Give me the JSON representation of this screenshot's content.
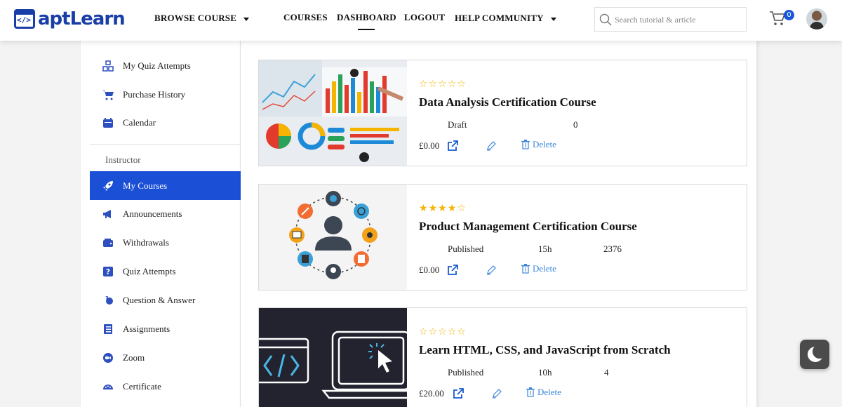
{
  "header": {
    "logo_text": "aptLearn",
    "logo_icon_text": "</>",
    "nav": {
      "browse_course": "BROWSE COURSE",
      "courses": "COURSES",
      "dashboard": "DASHBOARD",
      "logout": "LOGOUT",
      "help_community": "HELP COMMUNITY"
    },
    "search_placeholder": "Search tutorial & article",
    "cart_count": "0"
  },
  "sidebar": {
    "items_top": [
      {
        "label": "My Quiz Attempts",
        "icon": "quiz-attempts-icon"
      },
      {
        "label": "Purchase History",
        "icon": "cart-icon"
      },
      {
        "label": "Calendar",
        "icon": "calendar-icon"
      }
    ],
    "instructor_heading": "Instructor",
    "items_instructor": [
      {
        "label": "My Courses",
        "icon": "rocket-icon",
        "active": true
      },
      {
        "label": "Announcements",
        "icon": "megaphone-icon"
      },
      {
        "label": "Withdrawals",
        "icon": "wallet-icon"
      },
      {
        "label": "Quiz Attempts",
        "icon": "question-icon"
      },
      {
        "label": "Question & Answer",
        "icon": "qa-icon"
      },
      {
        "label": "Assignments",
        "icon": "assignments-icon"
      },
      {
        "label": "Zoom",
        "icon": "zoom-icon"
      },
      {
        "label": "Certificate",
        "icon": "certificate-icon"
      }
    ]
  },
  "courses": [
    {
      "title": "Data Analysis Certification Course",
      "rating": 0,
      "status": "Draft",
      "duration": "",
      "students": "0",
      "price": "£0.00",
      "delete_label": "Delete",
      "thumbnail": "data-analysis-charts"
    },
    {
      "title": "Product Management Certification Course",
      "rating": 4,
      "status": "Published",
      "duration": "15h",
      "students": "2376",
      "price": "£0.00",
      "delete_label": "Delete",
      "thumbnail": "product-management-person"
    },
    {
      "title": "Learn HTML, CSS, and JavaScript from Scratch",
      "rating": 0,
      "status": "Published",
      "duration": "10h",
      "students": "4",
      "price": "£20.00",
      "delete_label": "Delete",
      "thumbnail": "code-laptop"
    }
  ],
  "colors": {
    "brand": "#1a3ea8",
    "active": "#1a4fd6",
    "star": "#f4b400",
    "link": "#3a87d8"
  }
}
